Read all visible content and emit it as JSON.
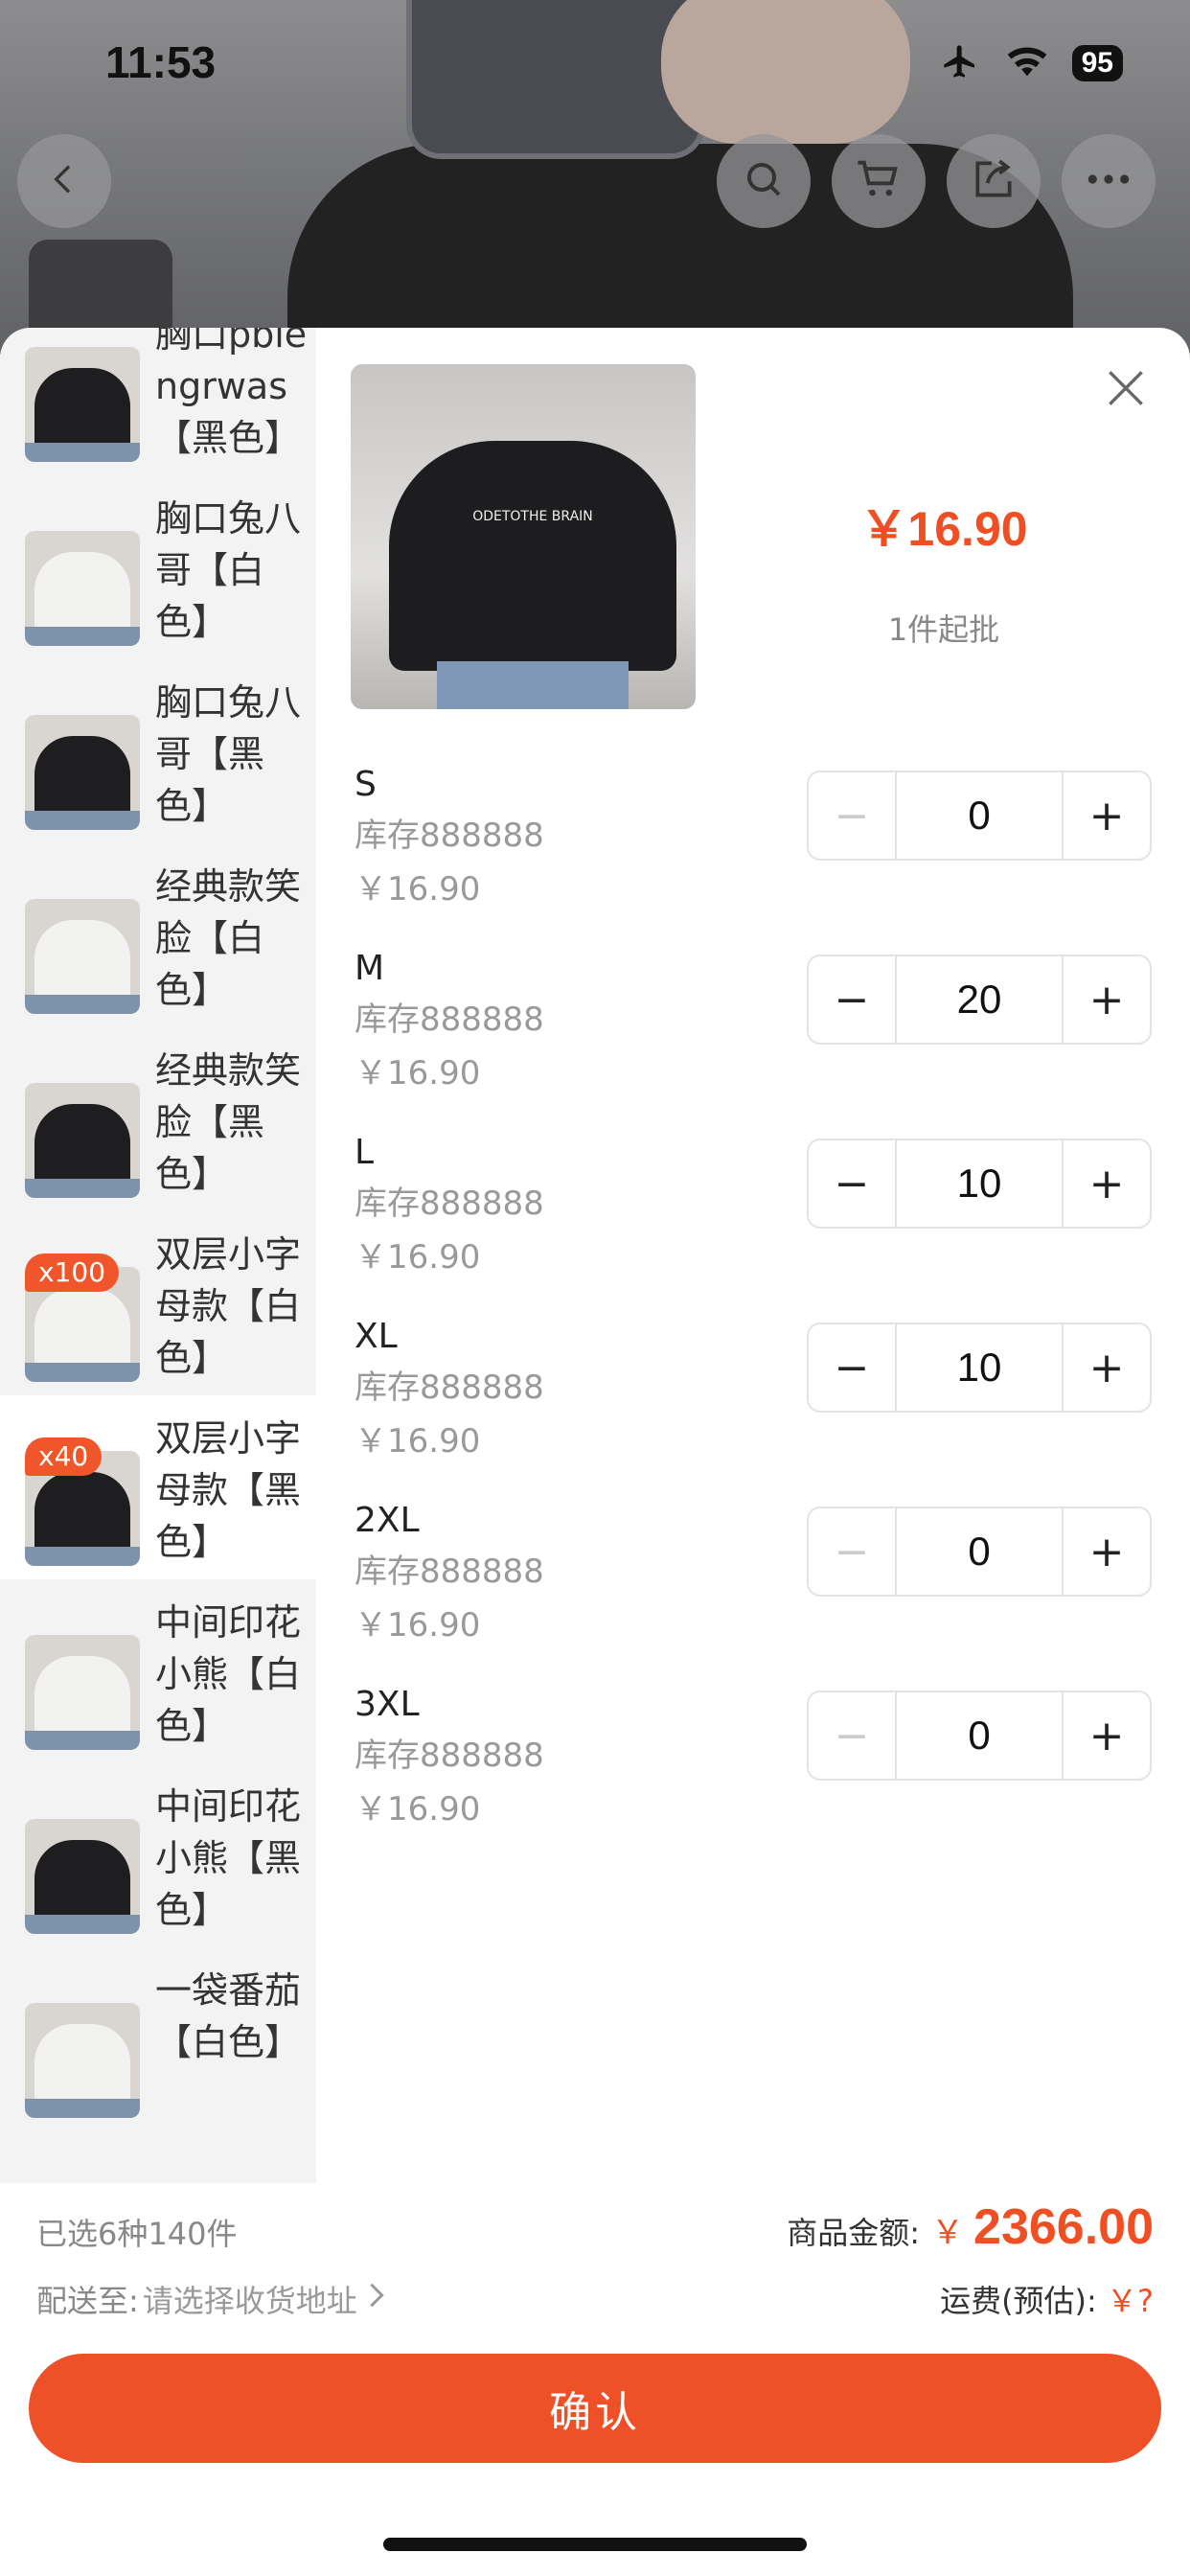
{
  "status_bar": {
    "time": "11:53",
    "battery": "95"
  },
  "nav": {
    "icons": [
      "back-icon",
      "search-icon",
      "cart-icon",
      "share-icon",
      "more-icon"
    ]
  },
  "variants": [
    {
      "label": "胸口pblengrwas【黑色】",
      "shirt_color": "#1e1e20",
      "badge": ""
    },
    {
      "label": "胸口兔八哥【白色】",
      "shirt_color": "#f2f2f0",
      "badge": ""
    },
    {
      "label": "胸口兔八哥【黑色】",
      "shirt_color": "#1e1e20",
      "badge": ""
    },
    {
      "label": "经典款笑脸【白色】",
      "shirt_color": "#f2f2f0",
      "badge": ""
    },
    {
      "label": "经典款笑脸【黑色】",
      "shirt_color": "#1e1e20",
      "badge": ""
    },
    {
      "label": "双层小字母款【白色】",
      "shirt_color": "#f2f2f0",
      "badge": "x100"
    },
    {
      "label": "双层小字母款【黑色】",
      "shirt_color": "#1e1e20",
      "badge": "x40",
      "active": true
    },
    {
      "label": "中间印花小熊【白色】",
      "shirt_color": "#f2f2f0",
      "badge": ""
    },
    {
      "label": "中间印花小熊【黑色】",
      "shirt_color": "#1e1e20",
      "badge": ""
    },
    {
      "label": "一袋番茄【白色】",
      "shirt_color": "#f2f2f0",
      "badge": ""
    }
  ],
  "product": {
    "image_text": "ODETOTHE BRAIN",
    "price": "￥16.90",
    "min_order": "1件起批"
  },
  "sizes": [
    {
      "name": "S",
      "stock": "库存888888",
      "price": "￥16.90",
      "qty": "0",
      "minus_disabled": true
    },
    {
      "name": "M",
      "stock": "库存888888",
      "price": "￥16.90",
      "qty": "20",
      "minus_disabled": false
    },
    {
      "name": "L",
      "stock": "库存888888",
      "price": "￥16.90",
      "qty": "10",
      "minus_disabled": false
    },
    {
      "name": "XL",
      "stock": "库存888888",
      "price": "￥16.90",
      "qty": "10",
      "minus_disabled": false
    },
    {
      "name": "2XL",
      "stock": "库存888888",
      "price": "￥16.90",
      "qty": "0",
      "minus_disabled": true
    },
    {
      "name": "3XL",
      "stock": "库存888888",
      "price": "￥16.90",
      "qty": "0",
      "minus_disabled": true
    }
  ],
  "stepper": {
    "minus": "−",
    "plus": "+"
  },
  "footer": {
    "selected_summary": "已选6种140件",
    "amount_label": "商品金额:",
    "amount_currency": "￥",
    "amount_value": "2366.00",
    "ship_label": "配送至:",
    "ship_address": "请选择收货地址",
    "freight_label": "运费(预估):",
    "freight_value": "￥?",
    "confirm_label": "确认"
  },
  "colors": {
    "accent": "#ee5128",
    "price": "#ef4f22",
    "list_bg": "#f3f3f3"
  }
}
